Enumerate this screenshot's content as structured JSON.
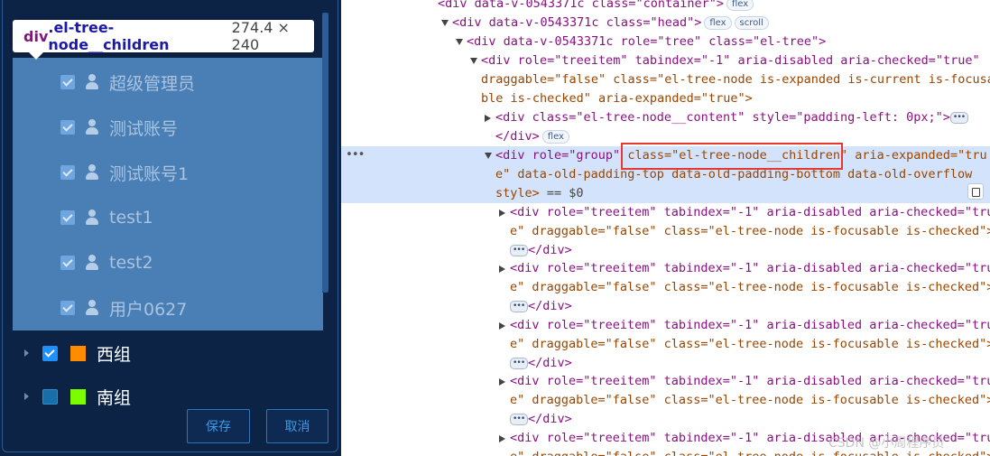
{
  "tooltip": {
    "tag": "div",
    "class_name": ".el-tree-node__children",
    "size": "274.4 × 240"
  },
  "tree": {
    "children": [
      "超级管理员",
      "测试账号",
      "测试账号1",
      "test1",
      "test2",
      "用户0627"
    ],
    "groups": [
      {
        "label": "西组",
        "checked": true,
        "color": "#ff8c00"
      },
      {
        "label": "南组",
        "checked": false,
        "color": "#7cfc00"
      }
    ]
  },
  "buttons": {
    "save": "保存",
    "cancel": "取消"
  },
  "devtools": {
    "lines": {
      "l0": "<div data-v-0543371c class=\"container\">",
      "l0_badge": "flex",
      "l1": "<div data-v-0543371c class=\"head\">",
      "l1_badge1": "flex",
      "l1_badge2": "scroll",
      "l2": "<div data-v-0543371c role=\"tree\" class=\"el-tree\">",
      "l3a": "<div role=\"treeitem\" tabindex=\"-1\" aria-disabled aria-checked=\"true\"",
      "l3b": "draggable=\"false\" class=\"el-tree-node is-expanded is-current is-focusa",
      "l3c": "ble is-checked\" aria-expanded=\"true\">",
      "l4": "<div class=\"el-tree-node__content\" style=\"padding-left: 0px;\">",
      "l4_close": "</div>",
      "l4_badge": "flex",
      "sel_a1": "<div role=\"group\" ",
      "sel_a2": "class=\"el-tree-node__children\"",
      "sel_a3": " aria-expanded=\"tru",
      "sel_b": "e\" data-old-padding-top data-old-padding-bottom data-old-overflow",
      "sel_c1": "style>",
      "sel_c2": " == $0",
      "item_a": "<div role=\"treeitem\" tabindex=\"-1\" aria-disabled aria-checked=\"tru",
      "item_b": "e\" draggable=\"false\" class=\"el-tree-node is-focusable is-checked\">",
      "item_c": "</div>"
    }
  },
  "watermark": "CSDN @小周程序员"
}
